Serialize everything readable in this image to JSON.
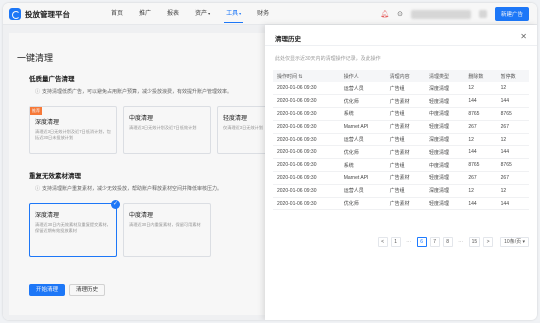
{
  "header": {
    "brand": "投放管理平台",
    "nav": [
      "首页",
      "推广",
      "报表",
      "资产",
      "工具",
      "财务"
    ],
    "active_nav": "工具",
    "new_ad_label": "新建广告"
  },
  "main": {
    "page_title": "一键清理",
    "low_quality": {
      "title": "低质量广告清理",
      "desc": "支持清理低质广告，可以避免占用账户预算，减少投放浪费，有效提升账户管理效率。",
      "options": [
        {
          "badge": "推荐",
          "title": "深度清理",
          "desc": "清理近3日无效计划及近7日低消计划，包括近30日未投放计划"
        },
        {
          "title": "中度清理",
          "desc": "清理近3日无效计划及近7日低效计划"
        },
        {
          "title": "轻度清理",
          "desc": "仅清理近3日无效计划"
        }
      ]
    },
    "duplicate": {
      "title": "重复无效素材清理",
      "desc": "支持清理账户重复素材，减少无效投放，帮助账户释放素材空间并降低审核压力。",
      "options": [
        {
          "title": "深度清理",
          "desc": "清理近30日内无效素材及重复提交素材，保留近期有效投放素材"
        },
        {
          "title": "中度清理",
          "desc": "清理近30日内重复素材，保留可用素材"
        }
      ]
    },
    "start_button": "开始清理",
    "history_button": "清理历史"
  },
  "drawer": {
    "title": "清理历史",
    "hint": "此处仅显示近30天内的清理操作记录，及此操作",
    "columns": [
      "操作时间",
      "操作人",
      "清理内容",
      "清理类型",
      "删除数",
      "暂停数"
    ],
    "rows": [
      [
        "2020-01-06  09:30",
        "运营人员",
        "广告组",
        "深度清理",
        "12",
        "12"
      ],
      [
        "2020-01-06  09:30",
        "优化师",
        "广告素材",
        "轻度清理",
        "144",
        "144"
      ],
      [
        "2020-01-06  09:30",
        "系统",
        "广告组",
        "中度清理",
        "8765",
        "8765"
      ],
      [
        "2020-01-06  09:30",
        "Marnet API",
        "广告素材",
        "轻度清理",
        "267",
        "267"
      ],
      [
        "2020-01-06  09:30",
        "运营人员",
        "广告组",
        "深度清理",
        "12",
        "12"
      ],
      [
        "2020-01-06  09:30",
        "优化师",
        "广告素材",
        "轻度清理",
        "144",
        "144"
      ],
      [
        "2020-01-06  09:30",
        "系统",
        "广告组",
        "中度清理",
        "8765",
        "8765"
      ],
      [
        "2020-01-06  09:30",
        "Marnet API",
        "广告素材",
        "轻度清理",
        "267",
        "267"
      ],
      [
        "2020-01-06  09:30",
        "运营人员",
        "广告组",
        "深度清理",
        "12",
        "12"
      ],
      [
        "2020-01-06  09:30",
        "优化师",
        "广告素材",
        "轻度清理",
        "144",
        "144"
      ]
    ],
    "pagination": {
      "prev": "<",
      "pages": [
        "1",
        "…",
        "6",
        "7",
        "8",
        "…",
        "15"
      ],
      "current": "6",
      "next": ">",
      "page_size": "10条/页"
    }
  },
  "colors": {
    "accent": "#1e7bff",
    "badge": "#ff7d3a"
  }
}
